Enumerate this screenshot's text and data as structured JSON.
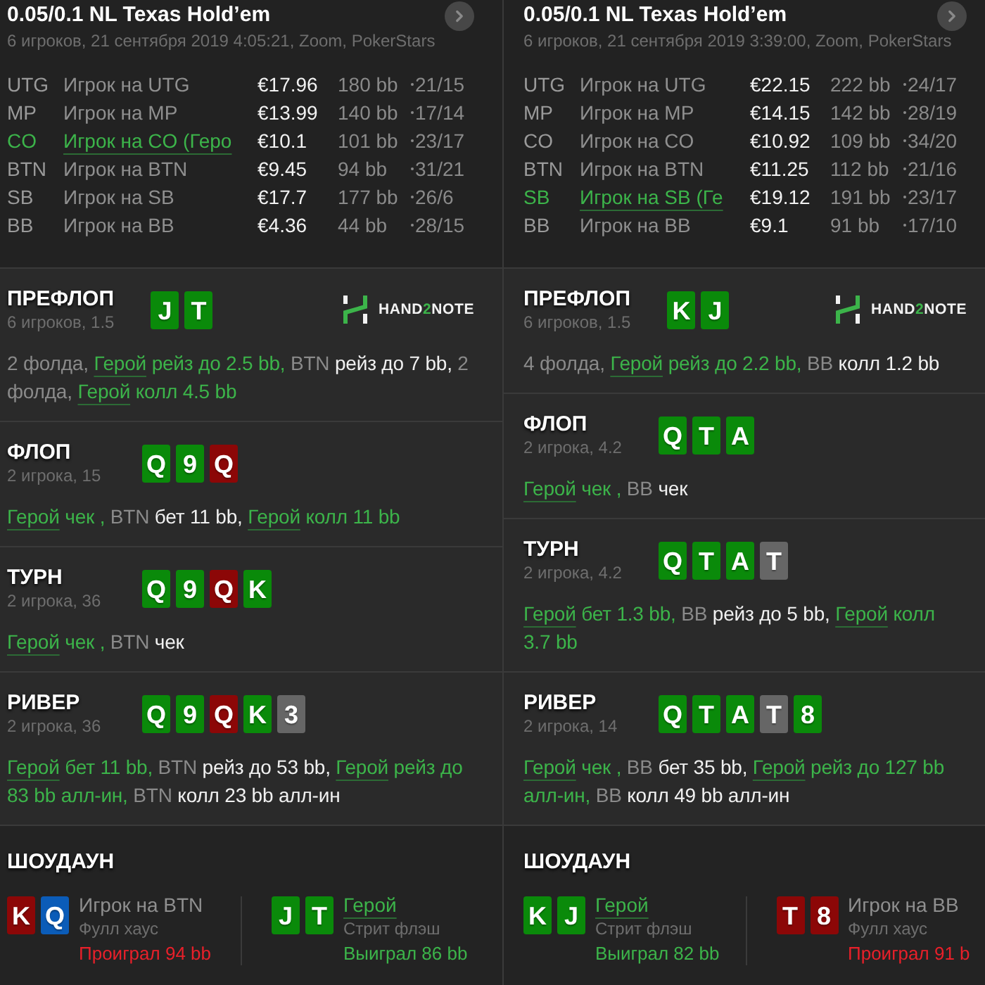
{
  "panels": [
    {
      "title": "0.05/0.1 NL Texas Hold’em",
      "subtitle": "6 игроков, 21 сентября 2019 4:05:21, Zoom, PokerStars",
      "players": [
        {
          "position": "UTG",
          "name": "Игрок на UTG",
          "hero": false,
          "stack": "€17.96",
          "bb": "180 bb",
          "stats": "21/15"
        },
        {
          "position": "MP",
          "name": "Игрок на MP",
          "hero": false,
          "stack": "€13.99",
          "bb": "140 bb",
          "stats": "17/14"
        },
        {
          "position": "CO",
          "name": "Игрок на CO (Геро",
          "hero": true,
          "stack": "€10.1",
          "bb": "101 bb",
          "stats": "23/17"
        },
        {
          "position": "BTN",
          "name": "Игрок на BTN",
          "hero": false,
          "stack": "€9.45",
          "bb": "94 bb",
          "stats": "31/21"
        },
        {
          "position": "SB",
          "name": "Игрок на SB",
          "hero": false,
          "stack": "€17.7",
          "bb": "177 bb",
          "stats": "26/6"
        },
        {
          "position": "BB",
          "name": "Игрок на BB",
          "hero": false,
          "stack": "€4.36",
          "bb": "44 bb",
          "stats": "28/15"
        }
      ],
      "streets": [
        {
          "title": "ПРЕФЛОП",
          "subtitle": "6 игроков, 1.5",
          "cards": [
            {
              "rank": "J",
              "color": "#0a8a0a"
            },
            {
              "rank": "T",
              "color": "#0a8a0a"
            }
          ],
          "logo": {
            "prefix": "HAND",
            "highlight": "2",
            "suffix": "NOTE"
          },
          "actions": [
            {
              "kind": "muted",
              "text": "2 фолда,"
            },
            {
              "kind": "link",
              "text": "Герой"
            },
            {
              "kind": "hero",
              "text": "рейз до 2.5 bb,"
            },
            {
              "kind": "muted",
              "text": "BTN"
            },
            {
              "kind": "villain",
              "text": "рейз до 7 bb,"
            },
            {
              "kind": "muted",
              "text": "2 фолда,"
            },
            {
              "kind": "link",
              "text": "Герой"
            },
            {
              "kind": "hero",
              "text": "колл 4.5 bb"
            }
          ]
        },
        {
          "title": "ФЛОП",
          "subtitle": "2 игрока, 15",
          "cards": [
            {
              "rank": "Q",
              "color": "#0a8a0a"
            },
            {
              "rank": "9",
              "color": "#0a8a0a"
            },
            {
              "rank": "Q",
              "color": "#8c0707"
            }
          ],
          "actions": [
            {
              "kind": "link",
              "text": "Герой"
            },
            {
              "kind": "hero",
              "text": "чек ,"
            },
            {
              "kind": "muted",
              "text": "BTN"
            },
            {
              "kind": "villain",
              "text": "бет 11 bb,"
            },
            {
              "kind": "link",
              "text": "Герой"
            },
            {
              "kind": "hero",
              "text": "колл 11 bb"
            }
          ]
        },
        {
          "title": "ТУРН",
          "subtitle": "2 игрока, 36",
          "cards": [
            {
              "rank": "Q",
              "color": "#0a8a0a"
            },
            {
              "rank": "9",
              "color": "#0a8a0a"
            },
            {
              "rank": "Q",
              "color": "#8c0707"
            },
            {
              "rank": "K",
              "color": "#0a8a0a"
            }
          ],
          "actions": [
            {
              "kind": "link",
              "text": "Герой"
            },
            {
              "kind": "hero",
              "text": "чек ,"
            },
            {
              "kind": "muted",
              "text": "BTN"
            },
            {
              "kind": "villain",
              "text": "чек"
            }
          ]
        },
        {
          "title": "РИВЕР",
          "subtitle": "2 игрока, 36",
          "cards": [
            {
              "rank": "Q",
              "color": "#0a8a0a"
            },
            {
              "rank": "9",
              "color": "#0a8a0a"
            },
            {
              "rank": "Q",
              "color": "#8c0707"
            },
            {
              "rank": "K",
              "color": "#0a8a0a"
            },
            {
              "rank": "3",
              "color": "#666666"
            }
          ],
          "actions": [
            {
              "kind": "link",
              "text": "Герой"
            },
            {
              "kind": "hero",
              "text": "бет 11 bb,"
            },
            {
              "kind": "muted",
              "text": "BTN"
            },
            {
              "kind": "villain",
              "text": "рейз до 53 bb,"
            },
            {
              "kind": "link",
              "text": "Герой"
            },
            {
              "kind": "hero",
              "text": "рейз до 83 bb алл-ин,"
            },
            {
              "kind": "muted",
              "text": "BTN"
            },
            {
              "kind": "villain",
              "text": "колл 23 bb алл-ин"
            }
          ]
        }
      ],
      "showdown": {
        "title": "ШОУДАУН",
        "hands": [
          {
            "cards": [
              {
                "rank": "K",
                "color": "#8c0707"
              },
              {
                "rank": "Q",
                "color": "#0b5cb8"
              }
            ],
            "name": "Игрок на BTN",
            "hero": false,
            "hand": "Фулл хаус",
            "result": "Проиграл 94 bb",
            "won": false
          },
          {
            "cards": [
              {
                "rank": "J",
                "color": "#0a8a0a"
              },
              {
                "rank": "T",
                "color": "#0a8a0a"
              }
            ],
            "name": "Герой",
            "hero": true,
            "hand": "Стрит флэш",
            "result": "Выиграл 86 bb",
            "won": true
          }
        ]
      }
    },
    {
      "title": "0.05/0.1 NL Texas Hold’em",
      "subtitle": "6 игроков, 21 сентября 2019 3:39:00, Zoom, PokerStars",
      "players": [
        {
          "position": "UTG",
          "name": "Игрок на UTG",
          "hero": false,
          "stack": "€22.15",
          "bb": "222 bb",
          "stats": "24/17"
        },
        {
          "position": "MP",
          "name": "Игрок на MP",
          "hero": false,
          "stack": "€14.15",
          "bb": "142 bb",
          "stats": "28/19"
        },
        {
          "position": "CO",
          "name": "Игрок на CO",
          "hero": false,
          "stack": "€10.92",
          "bb": "109 bb",
          "stats": "34/20"
        },
        {
          "position": "BTN",
          "name": "Игрок на BTN",
          "hero": false,
          "stack": "€11.25",
          "bb": "112 bb",
          "stats": "21/16"
        },
        {
          "position": "SB",
          "name": "Игрок на SB (Ге",
          "hero": true,
          "stack": "€19.12",
          "bb": "191 bb",
          "stats": "23/17"
        },
        {
          "position": "BB",
          "name": "Игрок на BB",
          "hero": false,
          "stack": "€9.1",
          "bb": "91 bb",
          "stats": "17/10"
        }
      ],
      "streets": [
        {
          "title": "ПРЕФЛОП",
          "subtitle": "6 игроков, 1.5",
          "cards": [
            {
              "rank": "K",
              "color": "#0a8a0a"
            },
            {
              "rank": "J",
              "color": "#0a8a0a"
            }
          ],
          "logo": {
            "prefix": "HAND",
            "highlight": "2",
            "suffix": "NOTE"
          },
          "actions": [
            {
              "kind": "muted",
              "text": "4 фолда,"
            },
            {
              "kind": "link",
              "text": "Герой"
            },
            {
              "kind": "hero",
              "text": "рейз до 2.2 bb,"
            },
            {
              "kind": "muted",
              "text": "BB"
            },
            {
              "kind": "villain",
              "text": "колл 1.2 bb"
            }
          ]
        },
        {
          "title": "ФЛОП",
          "subtitle": "2 игрока, 4.2",
          "cards": [
            {
              "rank": "Q",
              "color": "#0a8a0a"
            },
            {
              "rank": "T",
              "color": "#0a8a0a"
            },
            {
              "rank": "A",
              "color": "#0a8a0a"
            }
          ],
          "actions": [
            {
              "kind": "link",
              "text": "Герой"
            },
            {
              "kind": "hero",
              "text": "чек ,"
            },
            {
              "kind": "muted",
              "text": "BB"
            },
            {
              "kind": "villain",
              "text": "чек"
            }
          ]
        },
        {
          "title": "ТУРН",
          "subtitle": "2 игрока, 4.2",
          "cards": [
            {
              "rank": "Q",
              "color": "#0a8a0a"
            },
            {
              "rank": "T",
              "color": "#0a8a0a"
            },
            {
              "rank": "A",
              "color": "#0a8a0a"
            },
            {
              "rank": "T",
              "color": "#666666"
            }
          ],
          "actions": [
            {
              "kind": "link",
              "text": "Герой"
            },
            {
              "kind": "hero",
              "text": "бет 1.3 bb,"
            },
            {
              "kind": "muted",
              "text": "BB"
            },
            {
              "kind": "villain",
              "text": "рейз до 5 bb,"
            },
            {
              "kind": "link",
              "text": "Герой"
            },
            {
              "kind": "hero",
              "text": "колл 3.7 bb"
            }
          ]
        },
        {
          "title": "РИВЕР",
          "subtitle": "2 игрока, 14",
          "cards": [
            {
              "rank": "Q",
              "color": "#0a8a0a"
            },
            {
              "rank": "T",
              "color": "#0a8a0a"
            },
            {
              "rank": "A",
              "color": "#0a8a0a"
            },
            {
              "rank": "T",
              "color": "#666666"
            },
            {
              "rank": "8",
              "color": "#0a8a0a"
            }
          ],
          "actions": [
            {
              "kind": "link",
              "text": "Герой"
            },
            {
              "kind": "hero",
              "text": "чек ,"
            },
            {
              "kind": "muted",
              "text": "BB"
            },
            {
              "kind": "villain",
              "text": "бет 35 bb,"
            },
            {
              "kind": "link",
              "text": "Герой"
            },
            {
              "kind": "hero",
              "text": "рейз до 127 bb алл-ин,"
            },
            {
              "kind": "muted",
              "text": "BB"
            },
            {
              "kind": "villain",
              "text": "колл 49 bb алл-ин"
            }
          ]
        }
      ],
      "showdown": {
        "title": "ШОУДАУН",
        "hands": [
          {
            "cards": [
              {
                "rank": "K",
                "color": "#0a8a0a"
              },
              {
                "rank": "J",
                "color": "#0a8a0a"
              }
            ],
            "name": "Герой",
            "hero": true,
            "hand": "Стрит флэш",
            "result": "Выиграл 82 bb",
            "won": true
          },
          {
            "cards": [
              {
                "rank": "T",
                "color": "#8c0707"
              },
              {
                "rank": "8",
                "color": "#8c0707"
              }
            ],
            "name": "Игрок на BB",
            "hero": false,
            "hand": "Фулл хаус",
            "result": "Проиграл 91 b",
            "won": false
          }
        ]
      }
    }
  ]
}
